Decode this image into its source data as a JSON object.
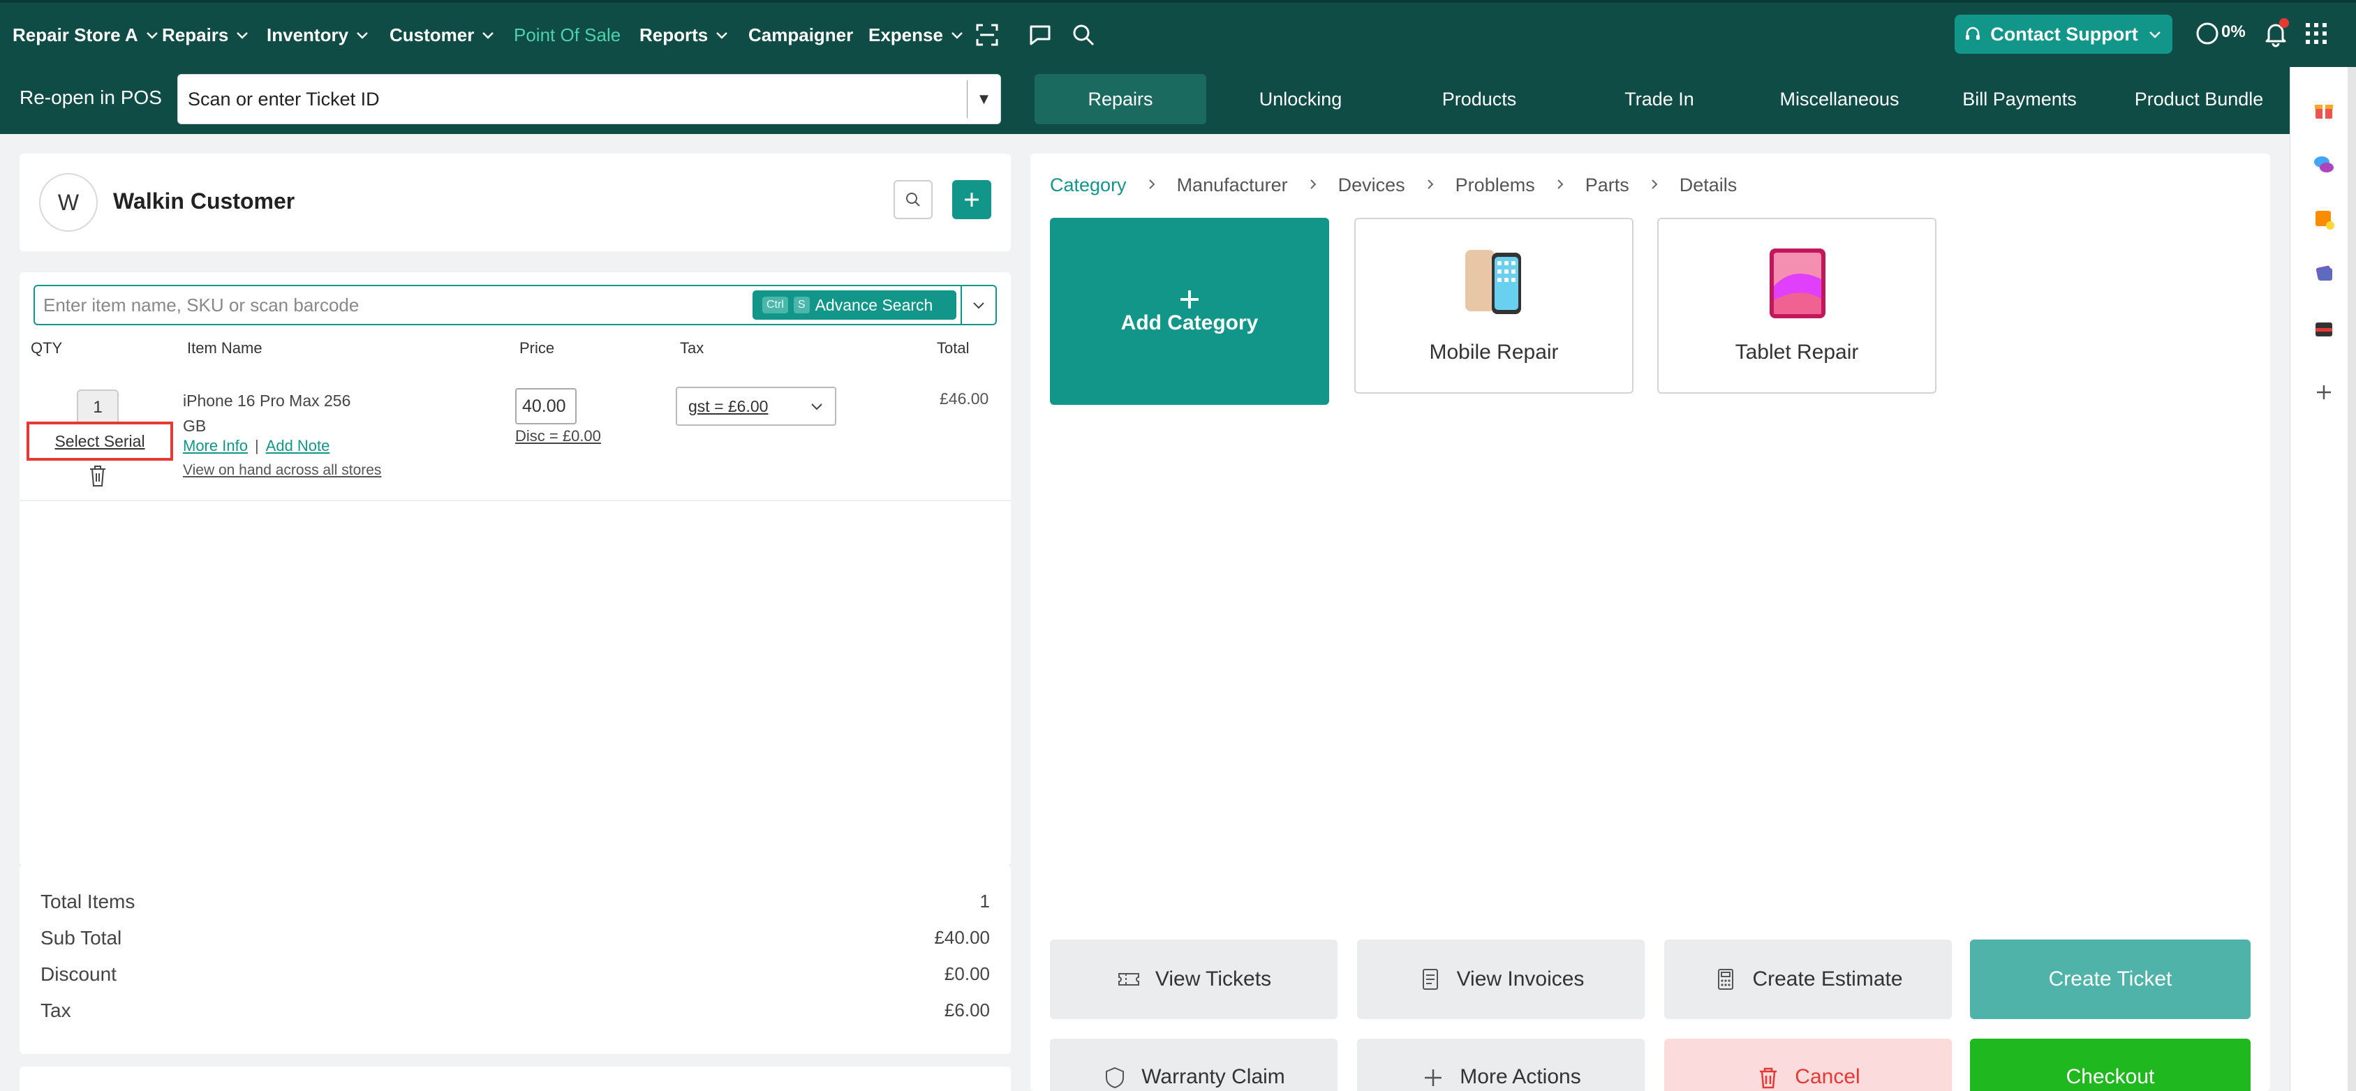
{
  "nav": {
    "store": "Repair Store A",
    "items": [
      {
        "label": "Repairs"
      },
      {
        "label": "Inventory"
      },
      {
        "label": "Customer"
      },
      {
        "label": "Point Of Sale"
      },
      {
        "label": "Reports"
      },
      {
        "label": "Campaigner"
      },
      {
        "label": "Expense"
      }
    ],
    "contact_support": "Contact Support",
    "progress": "0%"
  },
  "subbar": {
    "reopen_label": "Re-open in POS",
    "ticket_placeholder": "Scan or enter Ticket ID",
    "tabs": [
      "Repairs",
      "Unlocking",
      "Products",
      "Trade In",
      "Miscellaneous",
      "Bill Payments",
      "Product Bundle"
    ],
    "active_tab": "Repairs"
  },
  "customer": {
    "initial": "W",
    "name": "Walkin Customer"
  },
  "cart": {
    "search_placeholder": "Enter item name, SKU or scan barcode",
    "kbd_ctrl": "Ctrl",
    "kbd_s": "S",
    "advance_search": "Advance Search",
    "columns": {
      "qty": "QTY",
      "item": "Item Name",
      "price": "Price",
      "tax": "Tax",
      "total": "Total"
    },
    "line": {
      "qty": "1",
      "select_serial": "Select Serial",
      "name": "iPhone 16 Pro Max 256 GB",
      "more_info": "More Info",
      "add_note": "Add Note",
      "view_on_hand": "View on hand across all stores",
      "price": "40.00",
      "discount": "Disc = £0.00",
      "tax": "gst = £6.00",
      "total": "£46.00"
    }
  },
  "totals": {
    "total_items_label": "Total Items",
    "total_items": "1",
    "subtotal_label": "Sub Total",
    "subtotal": "£40.00",
    "discount_label": "Discount",
    "discount": "£0.00",
    "tax_label": "Tax",
    "tax": "£6.00"
  },
  "catalog": {
    "breadcrumb": [
      "Category",
      "Manufacturer",
      "Devices",
      "Problems",
      "Parts",
      "Details"
    ],
    "add_category": "Add Category",
    "tiles": [
      "Mobile Repair",
      "Tablet Repair"
    ]
  },
  "actions": {
    "view_tickets": "View Tickets",
    "view_invoices": "View Invoices",
    "create_estimate": "Create Estimate",
    "create_ticket": "Create Ticket",
    "warranty_claim": "Warranty Claim",
    "more_actions": "More Actions",
    "cancel": "Cancel",
    "checkout": "Checkout"
  },
  "colors": {
    "nav_bg": "#0f4c45",
    "accent": "#12968a",
    "active_nav": "#4ed1ad",
    "checkout": "#1fb81f",
    "cancel_text": "#e53935",
    "highlight_box": "#e53935"
  },
  "icons": [
    "chevron-down-icon",
    "scan-icon",
    "chat-icon",
    "search-icon",
    "headset-icon",
    "bell-icon",
    "apps-grid-icon",
    "trash-icon",
    "ticket-icon",
    "invoice-icon",
    "calculator-icon",
    "shield-icon",
    "plus-icon"
  ]
}
